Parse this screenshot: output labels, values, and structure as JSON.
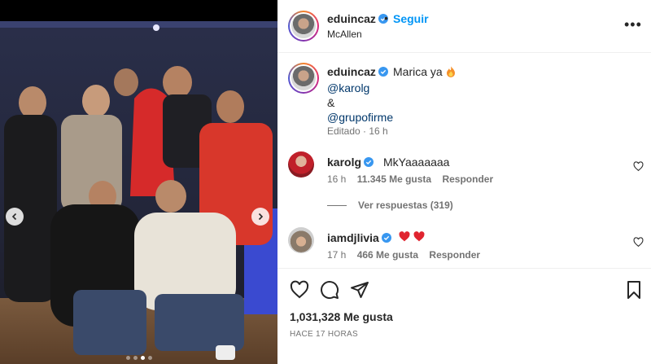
{
  "header": {
    "username": "eduincaz",
    "follow_label": "Seguir",
    "bullet": "•",
    "location": "McAllen",
    "more_icon": "more-icon"
  },
  "caption": {
    "username": "eduincaz",
    "text": "Marica ya",
    "emoji": "fire-emoji",
    "mention_1": "@karolg",
    "amp": "&",
    "mention_2": "@grupofirme",
    "edited": "Editado · 16 h"
  },
  "comments": [
    {
      "username": "karolg",
      "text": "MkYaaaaaaa",
      "age": "16 h",
      "likes": "11.345 Me gusta",
      "reply_label": "Responder"
    },
    {
      "username": "iamdjlivia",
      "emoji": "red-hearts",
      "age": "17 h",
      "likes": "466 Me gusta",
      "reply_label": "Responder"
    }
  ],
  "replies_label": "Ver respuestas (319)",
  "actions": {
    "likes": "1,031,328 Me gusta",
    "time": "HACE 17 HORAS"
  },
  "carousel": {
    "slide_count": 4,
    "active_slide": 3
  },
  "colors": {
    "link_blue": "#0095f6",
    "mention_blue": "#00376b",
    "verified_blue": "#3897f0",
    "heart_red": "#ed4956"
  }
}
